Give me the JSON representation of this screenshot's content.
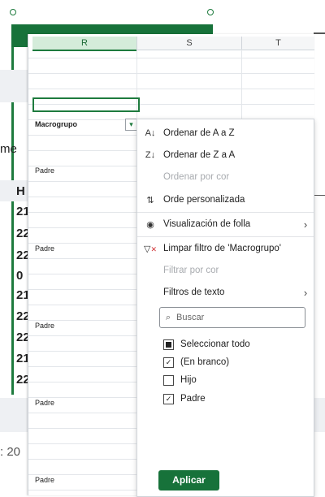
{
  "background": {
    "partial_text": [
      "me",
      "H",
      "21",
      "22",
      "22",
      "0",
      "21",
      "22",
      "22",
      "21",
      "22",
      ": 20"
    ]
  },
  "sheet": {
    "columns": [
      "R",
      "S",
      "T"
    ],
    "header_cell": "Macrogrupo",
    "filter_glyph": "▾",
    "values": [
      "Padre",
      "Padre",
      "Padre",
      "Padre",
      "Padre"
    ]
  },
  "menu": {
    "sort_az": "Ordenar de A a Z",
    "sort_za": "Ordenar de Z a A",
    "sort_color": "Ordenar por cor",
    "custom_sort": "Orde personalizada",
    "sheet_view": "Visualización de folla",
    "clear_filter": "Limpar filtro de 'Macrogrupo'",
    "filter_color": "Filtrar por cor",
    "text_filters": "Filtros de texto",
    "search_placeholder": "Buscar",
    "checkboxes": [
      {
        "label": "Seleccionar todo",
        "state": "partial"
      },
      {
        "label": "(En branco)",
        "state": "checked"
      },
      {
        "label": "Hijo",
        "state": "unchecked"
      },
      {
        "label": "Padre",
        "state": "checked"
      }
    ],
    "apply_label": "Aplicar"
  },
  "colors": {
    "accent": "#17723a",
    "disabled": "#a8abaf"
  }
}
